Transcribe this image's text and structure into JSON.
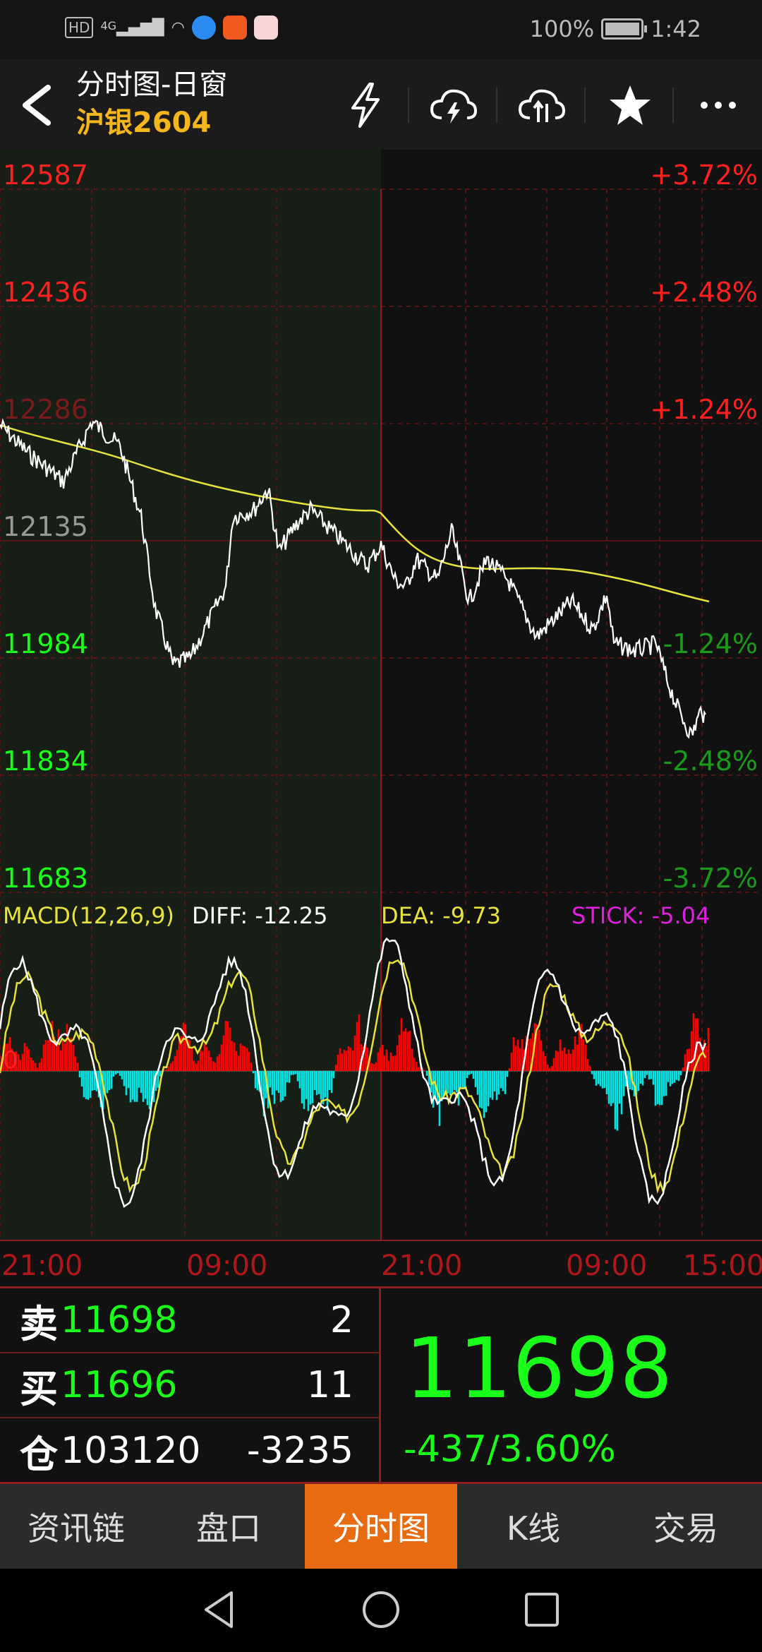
{
  "status": {
    "left_labels": [
      "HD",
      "4G"
    ],
    "battery": "100%",
    "time": "1:42"
  },
  "header": {
    "title": "分时图-日窗",
    "symbol": "沪银2604",
    "icons": [
      "lightning-icon",
      "cloud-bolt-icon",
      "cloud-sync-icon",
      "star-icon",
      "more-icon"
    ]
  },
  "chart": {
    "price_levels": [
      "12587",
      "12436",
      "12286",
      "12135",
      "11984",
      "11834",
      "11683"
    ],
    "pct_levels": [
      "+3.72%",
      "+2.48%",
      "+1.24%",
      "",
      "-1.24%",
      "-2.48%",
      "-3.72%"
    ],
    "macd_title": "MACD(12,26,9)",
    "diff": "DIFF: -12.25",
    "dea": "DEA: -9.73",
    "stick": "STICK: -5.04",
    "zero_label": "0",
    "time_labels": [
      "21:00",
      "09:00",
      "21:00",
      "09:00",
      "15:00"
    ],
    "colors": {
      "up": "#ff2020",
      "down": "#1aff1a",
      "grid": "#6b1212",
      "price_line": "#ffffff",
      "avg_line": "#e8e23c",
      "macd_up": "#ff0000",
      "macd_down": "#00e5e5",
      "stick": "#e020e0"
    }
  },
  "quote": {
    "sell_key": "卖",
    "sell_price": "11698",
    "sell_qty": "2",
    "buy_key": "买",
    "buy_price": "11696",
    "buy_qty": "11",
    "oi_key": "仓",
    "oi_value": "103120",
    "oi_change": "-3235",
    "last_price": "11698",
    "change": "-437/3.60%"
  },
  "tabs": [
    "资讯链",
    "盘口",
    "分时图",
    "K线",
    "交易"
  ],
  "active_tab": 2
}
